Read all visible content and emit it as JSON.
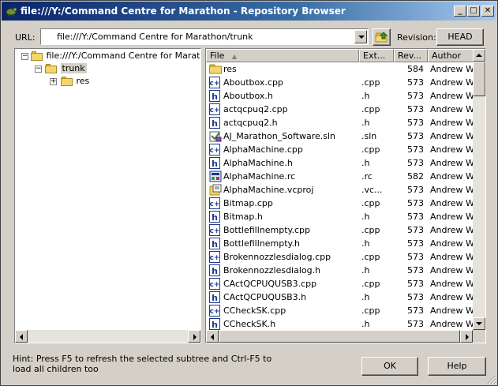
{
  "window": {
    "title": "file:///Y:/Command Centre for Marathon - Repository Browser",
    "controls": {
      "minimize": "_",
      "maximize": "□",
      "close": "✕"
    }
  },
  "toolbar": {
    "url_label": "URL:",
    "url_value": "file:///Y:/Command Centre for Marathon/trunk",
    "revision_label": "Revision:",
    "revision_button": "HEAD"
  },
  "tree": {
    "root": "file:///Y:/Command Centre for Marathon",
    "child": "trunk",
    "grandchild": "res"
  },
  "filelist": {
    "columns": [
      "File",
      "Ext...",
      "Rev...",
      "Author"
    ],
    "rows": [
      {
        "name": "res",
        "ext": "",
        "rev": "584",
        "author": "Andrew We",
        "icon": "folder-icon"
      },
      {
        "name": "Aboutbox.cpp",
        "ext": ".cpp",
        "rev": "573",
        "author": "Andrew We",
        "icon": "cpp-file-icon"
      },
      {
        "name": "Aboutbox.h",
        "ext": ".h",
        "rev": "573",
        "author": "Andrew We",
        "icon": "header-file-icon"
      },
      {
        "name": "actqcpuq2.cpp",
        "ext": ".cpp",
        "rev": "573",
        "author": "Andrew We",
        "icon": "cpp-file-icon"
      },
      {
        "name": "actqcpuq2.h",
        "ext": ".h",
        "rev": "573",
        "author": "Andrew We",
        "icon": "header-file-icon"
      },
      {
        "name": "AJ_Marathon_Software.sln",
        "ext": ".sln",
        "rev": "573",
        "author": "Andrew We",
        "icon": "solution-file-icon"
      },
      {
        "name": "AlphaMachine.cpp",
        "ext": ".cpp",
        "rev": "573",
        "author": "Andrew We",
        "icon": "cpp-file-icon"
      },
      {
        "name": "AlphaMachine.h",
        "ext": ".h",
        "rev": "573",
        "author": "Andrew We",
        "icon": "header-file-icon"
      },
      {
        "name": "AlphaMachine.rc",
        "ext": ".rc",
        "rev": "582",
        "author": "Andrew We",
        "icon": "resource-file-icon"
      },
      {
        "name": "AlphaMachine.vcproj",
        "ext": ".vc...",
        "rev": "573",
        "author": "Andrew We",
        "icon": "project-file-icon"
      },
      {
        "name": "Bitmap.cpp",
        "ext": ".cpp",
        "rev": "573",
        "author": "Andrew We",
        "icon": "cpp-file-icon"
      },
      {
        "name": "Bitmap.h",
        "ext": ".h",
        "rev": "573",
        "author": "Andrew We",
        "icon": "header-file-icon"
      },
      {
        "name": "Bottlefillnempty.cpp",
        "ext": ".cpp",
        "rev": "573",
        "author": "Andrew We",
        "icon": "cpp-file-icon"
      },
      {
        "name": "Bottlefillnempty.h",
        "ext": ".h",
        "rev": "573",
        "author": "Andrew We",
        "icon": "header-file-icon"
      },
      {
        "name": "Brokennozzlesdialog.cpp",
        "ext": ".cpp",
        "rev": "573",
        "author": "Andrew We",
        "icon": "cpp-file-icon"
      },
      {
        "name": "Brokennozzlesdialog.h",
        "ext": ".h",
        "rev": "573",
        "author": "Andrew We",
        "icon": "header-file-icon"
      },
      {
        "name": "CActQCPUQUSB3.cpp",
        "ext": ".cpp",
        "rev": "573",
        "author": "Andrew We",
        "icon": "cpp-file-icon"
      },
      {
        "name": "CActQCPUQUSB3.h",
        "ext": ".h",
        "rev": "573",
        "author": "Andrew We",
        "icon": "header-file-icon"
      },
      {
        "name": "CCheckSK.cpp",
        "ext": ".cpp",
        "rev": "573",
        "author": "Andrew We",
        "icon": "cpp-file-icon"
      },
      {
        "name": "CCheckSK.h",
        "ext": ".h",
        "rev": "573",
        "author": "Andrew We",
        "icon": "header-file-icon"
      }
    ]
  },
  "footer": {
    "hint": "Hint: Press F5 to refresh the selected subtree and Ctrl-F5 to load all children too",
    "ok": "OK",
    "help": "Help"
  },
  "colors": {
    "titlebar_start": "#0a246a",
    "titlebar_end": "#a6caf0",
    "selection": "#d4d0c8"
  }
}
